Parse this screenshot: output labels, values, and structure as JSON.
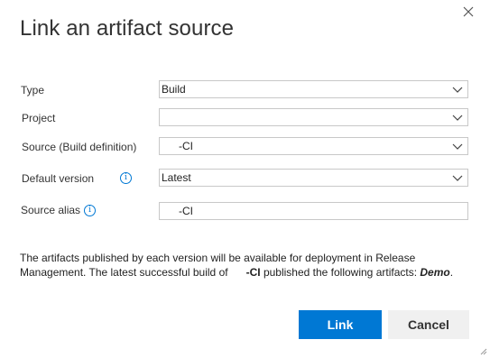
{
  "dialog": {
    "title": "Link an artifact source",
    "close_icon": "close-icon"
  },
  "form": {
    "type": {
      "label": "Type",
      "value": "Build"
    },
    "project": {
      "label": "Project",
      "value": ""
    },
    "source": {
      "label": "Source (Build definition)",
      "value": "-CI"
    },
    "default_version": {
      "label": "Default version",
      "value": "Latest",
      "icon": "info-icon"
    },
    "source_alias": {
      "label": "Source alias",
      "value": "-CI",
      "icon": "info-icon"
    }
  },
  "description": {
    "part1": "The artifacts published by each version will be available for deployment in Release Management. The latest successful build of",
    "definition": "-CI",
    "part2": "published the following artifacts:",
    "artifact": "Demo",
    "end": "."
  },
  "buttons": {
    "link": "Link",
    "cancel": "Cancel"
  },
  "colors": {
    "accent": "#0078d4",
    "secondary_button": "#f0f0f0",
    "border": "#c8c8c8"
  }
}
